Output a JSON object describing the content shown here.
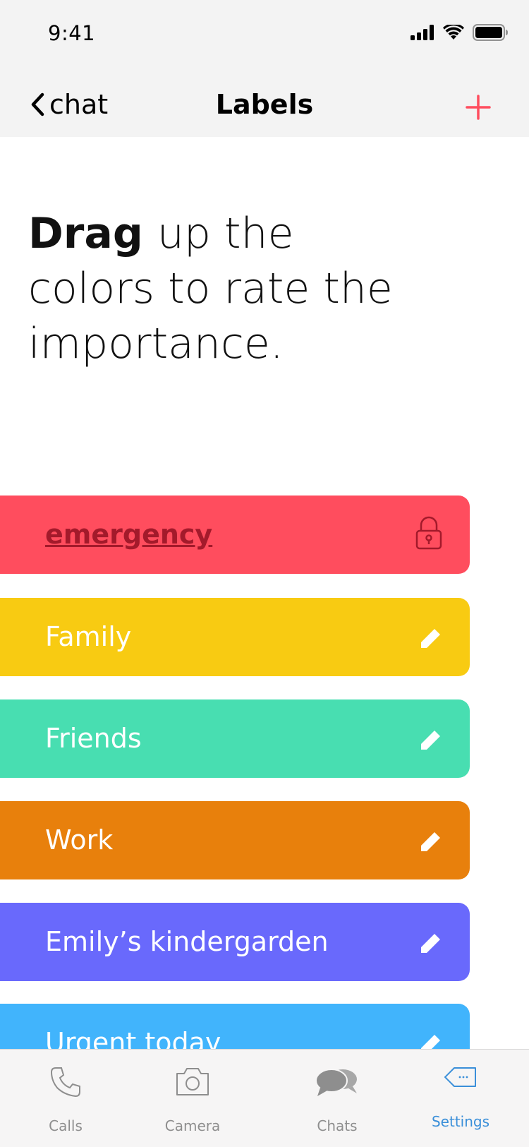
{
  "status_bar": {
    "time": "9:41"
  },
  "nav": {
    "back_label": "chat",
    "title": "Labels",
    "add_icon": "plus-icon"
  },
  "headline": {
    "strong": "Drag",
    "rest": "up the colors to rate the importance."
  },
  "labels": [
    {
      "name": "emergency",
      "color": "#ff4d5e",
      "icon": "lock-icon"
    },
    {
      "name": "Family",
      "color": "#f8cb12",
      "icon": "pencil-icon"
    },
    {
      "name": "Friends",
      "color": "#48deb1",
      "icon": "pencil-icon"
    },
    {
      "name": "Work",
      "color": "#e8800c",
      "icon": "pencil-icon"
    },
    {
      "name": "Emily’s kindergarden",
      "color": "#6969fc",
      "icon": "pencil-icon"
    },
    {
      "name": "Urgent today",
      "color": "#41b4fc",
      "icon": "pencil-icon"
    }
  ],
  "tabs": [
    {
      "label": "Calls",
      "icon": "phone-icon"
    },
    {
      "label": "Camera",
      "icon": "camera-icon"
    },
    {
      "label": "Chats",
      "icon": "chat-bubbles-icon"
    },
    {
      "label": "Settings",
      "icon": "tag-icon",
      "active": true
    }
  ],
  "colors": {
    "accent": "#ff4d5e",
    "active_tab": "#3a8fd9",
    "inactive_tab": "#8e8e8e"
  }
}
